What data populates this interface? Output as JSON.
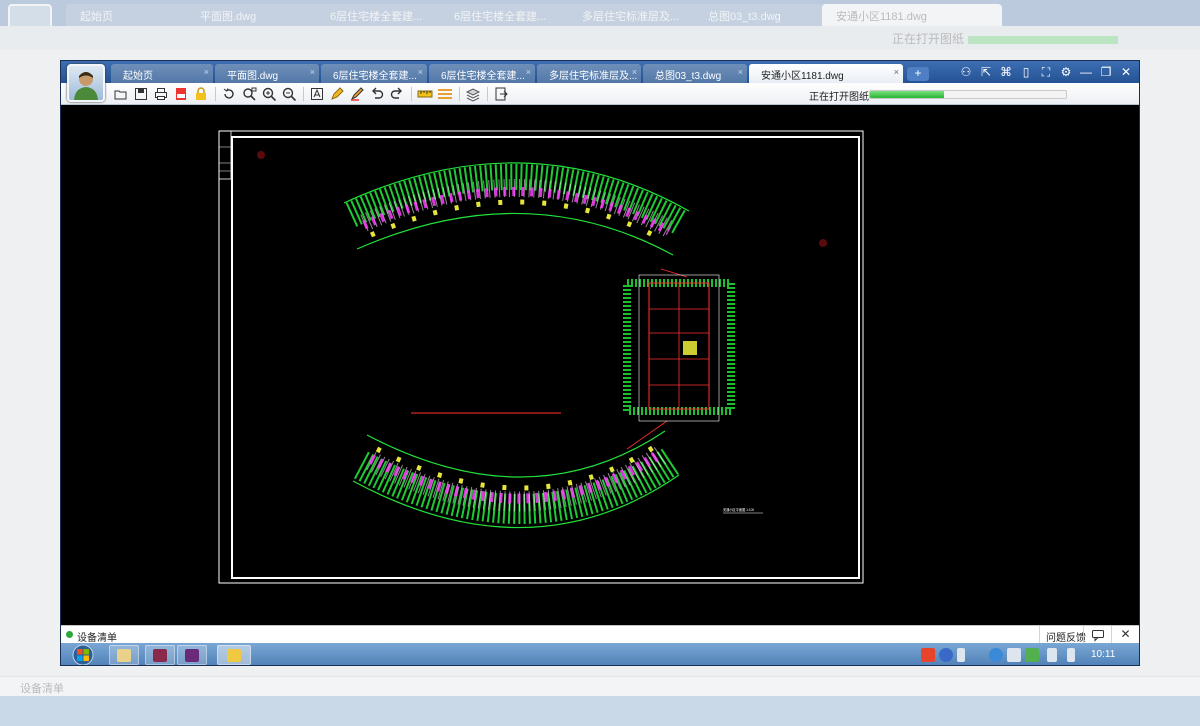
{
  "app": {
    "tabs": [
      {
        "label": "起始页"
      },
      {
        "label": "平面图.dwg"
      },
      {
        "label": "6层住宅楼全套建..."
      },
      {
        "label": "6层住宅楼全套建..."
      },
      {
        "label": "多层住宅标准层及..."
      },
      {
        "label": "总图03_t3.dwg"
      },
      {
        "label": "安通小区1181.dwg"
      }
    ],
    "active_tab_index": 6,
    "tab_close_glyph": "×",
    "new_tab_glyph": "+",
    "window_controls": [
      {
        "icon": "user-group-icon",
        "glyph": "⚇"
      },
      {
        "icon": "share-icon",
        "glyph": "⇱"
      },
      {
        "icon": "link-icon",
        "glyph": "⌘"
      },
      {
        "icon": "mobile-icon",
        "glyph": "▯"
      },
      {
        "icon": "fullscreen-icon",
        "glyph": "⛶"
      },
      {
        "icon": "settings-icon",
        "glyph": "⚙"
      },
      {
        "icon": "minimize-icon",
        "glyph": "—"
      },
      {
        "icon": "restore-icon",
        "glyph": "❐"
      },
      {
        "icon": "close-icon",
        "glyph": "✕"
      }
    ]
  },
  "toolbar": {
    "icons": [
      "open-folder-icon",
      "save-icon",
      "print-icon",
      "pdf-export-icon",
      "lock-icon",
      "rotate-icon",
      "zoom-window-icon",
      "zoom-in-icon",
      "zoom-out-icon",
      "text-icon",
      "pen-icon",
      "highlighter-icon",
      "undo-icon",
      "redo-icon",
      "measure-icon",
      "dimension-icon",
      "layers-icon",
      "export-icon"
    ],
    "loading_text": "正在打开图纸",
    "progress": 0.38
  },
  "drawing": {
    "title_label": "安通小区平面图  1:100"
  },
  "statusbar": {
    "label": "设备清单",
    "feedback": "问题反馈",
    "chat_glyph": "💬",
    "close_glyph": "✕"
  },
  "taskbar": {
    "clock": "10:11",
    "pinned": [
      {
        "icon": "explorer-icon",
        "color": "#e8d28a"
      },
      {
        "icon": "media-player-icon",
        "color": "#8a2a4a"
      },
      {
        "icon": "winrar-icon",
        "color": "#6a2a7a"
      },
      {
        "icon": "cad-viewer-icon",
        "color": "#f0c842"
      }
    ],
    "tray": [
      {
        "icon": "sogou-ime-icon",
        "color": "#e8442c"
      },
      {
        "icon": "help-icon",
        "color": "#3a6ac8"
      },
      {
        "icon": "arrow-icon",
        "color": "#dde6ef"
      },
      {
        "icon": "security-icon",
        "color": "#3a8ad8"
      },
      {
        "icon": "network-icon",
        "color": "#dde6ef"
      },
      {
        "icon": "battery-icon",
        "color": "#52b04e"
      },
      {
        "icon": "signal-icon",
        "color": "#dde6ef"
      },
      {
        "icon": "volume-icon",
        "color": "#dde6ef"
      }
    ]
  },
  "colors": {
    "cad_green": "#22e03a",
    "cad_white": "#ffffff",
    "cad_magenta": "#ff40ff",
    "cad_yellow": "#ffff40",
    "cad_red": "#ff3030",
    "title_blue": "#245294"
  }
}
